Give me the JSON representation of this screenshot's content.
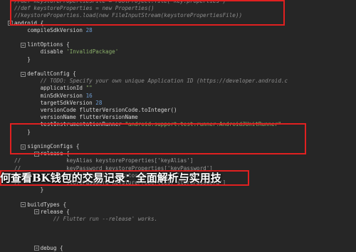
{
  "editor": {
    "lines": [
      [
        {
          "c": "com",
          "t": "//def keystorePropertiesFile = rootProject.file('key.properties')"
        }
      ],
      [
        {
          "c": "com",
          "t": "//def keystoreProperties = new Properties()"
        }
      ],
      [
        {
          "c": "com",
          "t": "//keystoreProperties.load(new FileInputStream(keystorePropertiesFile))"
        }
      ],
      [
        {
          "c": "kw",
          "t": "android {"
        }
      ],
      [
        {
          "c": "tx",
          "t": "    compileSdkVersion "
        },
        {
          "c": "num",
          "t": "28"
        }
      ],
      [],
      [
        {
          "c": "tx",
          "t": "    lintOptions {"
        }
      ],
      [
        {
          "c": "tx",
          "t": "        disable "
        },
        {
          "c": "str",
          "t": "'InvalidPackage'"
        }
      ],
      [
        {
          "c": "tx",
          "t": "    }"
        }
      ],
      [],
      [
        {
          "c": "tx",
          "t": "    defaultConfig {"
        }
      ],
      [
        {
          "c": "com",
          "t": "        // TODO: Specify your own unique Application ID (https://developer.android.c"
        }
      ],
      [
        {
          "c": "tx",
          "t": "        applicationId "
        },
        {
          "c": "str",
          "t": "\"\""
        }
      ],
      [
        {
          "c": "tx",
          "t": "        minSdkVersion "
        },
        {
          "c": "num",
          "t": "16"
        }
      ],
      [
        {
          "c": "tx",
          "t": "        targetSdkVersion "
        },
        {
          "c": "num",
          "t": "28"
        }
      ],
      [
        {
          "c": "tx",
          "t": "        versionCode flutterVersionCode.toInteger()"
        }
      ],
      [
        {
          "c": "tx",
          "t": "        versionName flutterVersionName"
        }
      ],
      [
        {
          "c": "tx",
          "t": "        testInstrumentationRunner "
        },
        {
          "c": "str",
          "t": "\"android.support.test.runner.AndroidJUnitRunner\""
        }
      ],
      [
        {
          "c": "tx",
          "t": "    }"
        }
      ],
      [],
      [
        {
          "c": "tx",
          "t": "    signingConfigs {"
        }
      ],
      [
        {
          "c": "tx",
          "t": "        release {"
        }
      ],
      [
        {
          "c": "hl-com",
          "t": "//              keyAlias keystoreProperties['keyAlias']"
        }
      ],
      [
        {
          "c": "hl-com",
          "t": "//              keyPassword keystoreProperties['keyPassword']"
        }
      ],
      [
        {
          "c": "hl-com",
          "t": "//              storeFile file(keystoreProperties['storeFile'])"
        }
      ],
      [
        {
          "c": "hl-com",
          "t": "//              storePassword keystoreProperties['storePassword']"
        }
      ],
      [
        {
          "c": "tx",
          "t": "        }"
        }
      ],
      [],
      [
        {
          "c": "tx",
          "t": "    buildTypes {"
        }
      ],
      [
        {
          "c": "tx",
          "t": "        release {"
        }
      ],
      [
        {
          "c": "com",
          "t": "            // Flutter run --release' works."
        }
      ],
      [],
      [],
      [],
      [
        {
          "c": "tx",
          "t": "        debug {"
        }
      ]
    ],
    "folds": [
      3,
      6,
      10,
      20,
      21,
      28,
      29,
      34
    ]
  },
  "overlay": {
    "title": "何查看BK钱包的交易记录：全面解析与实用技"
  },
  "colors": {
    "background": "#262626",
    "highlight_box": "#e02020"
  }
}
